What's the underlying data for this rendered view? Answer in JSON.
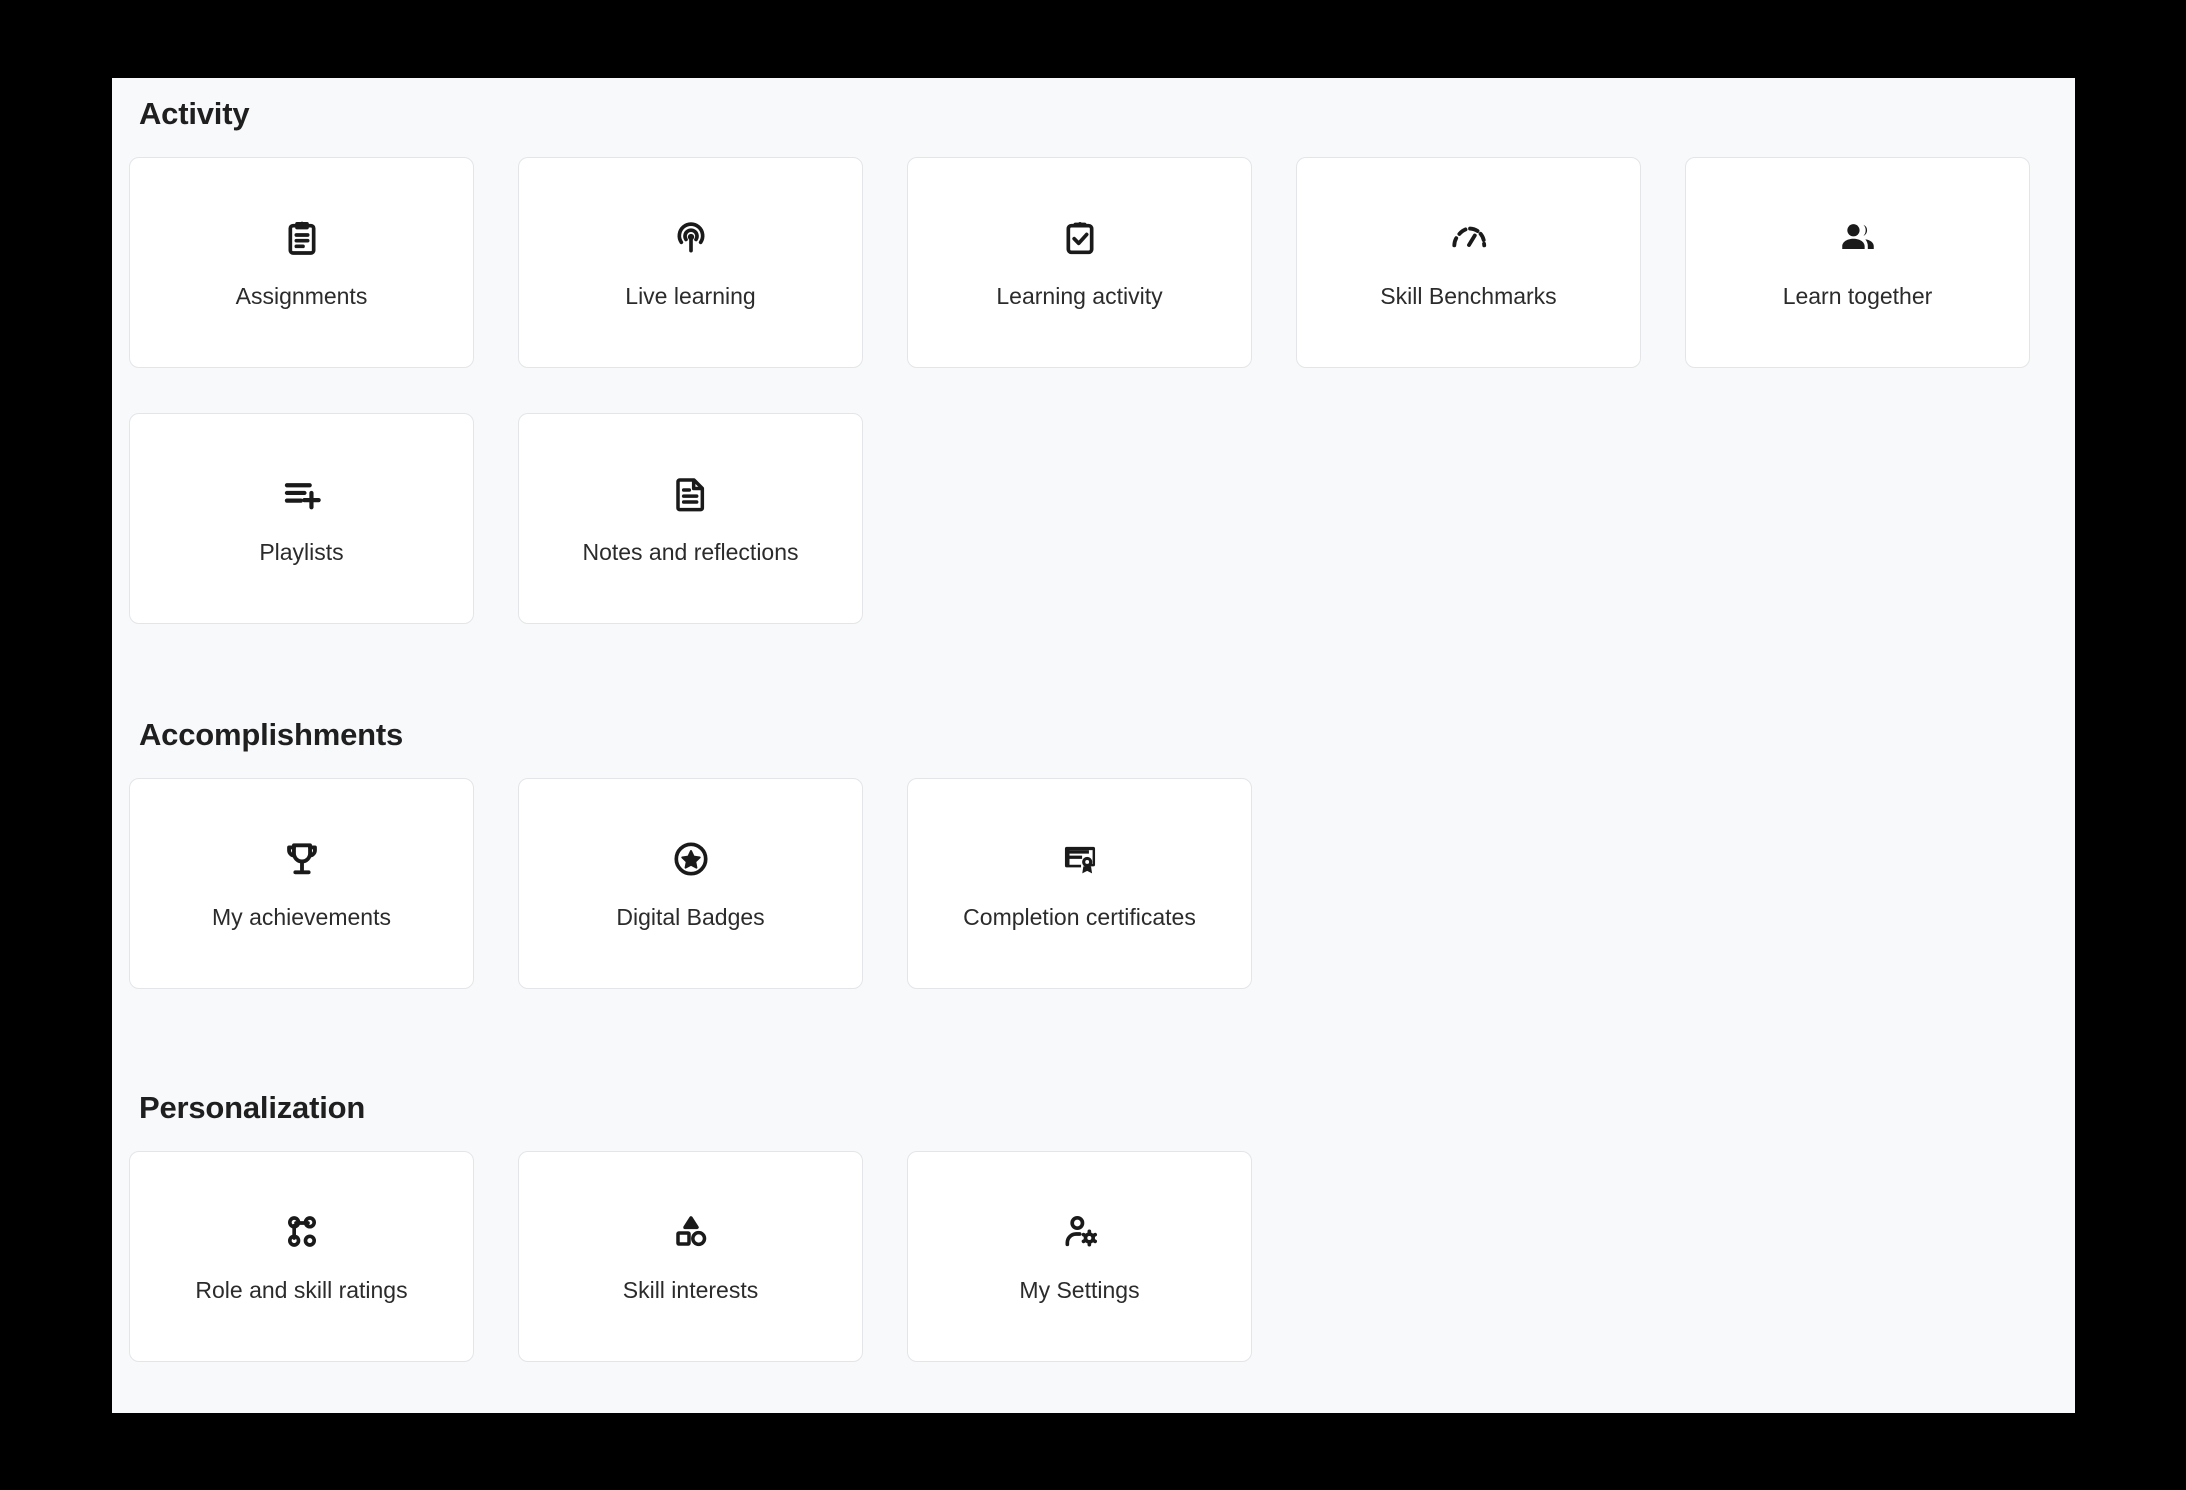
{
  "theme": {
    "page_background": "#000000",
    "content_background": "#f8f9fb",
    "card_background": "#ffffff",
    "card_border": "#e3e5e8",
    "heading_color": "#1f1f1f",
    "label_color": "#2b2b2b",
    "icon_color": "#1a1a1a"
  },
  "sections": {
    "activity": {
      "title": "Activity",
      "cards": [
        {
          "label": "Assignments",
          "icon": "clipboard-lines-icon"
        },
        {
          "label": "Live learning",
          "icon": "broadcast-antenna-icon"
        },
        {
          "label": "Learning activity",
          "icon": "clipboard-check-icon"
        },
        {
          "label": "Skill Benchmarks",
          "icon": "gauge-icon"
        },
        {
          "label": "Learn together",
          "icon": "people-group-icon"
        },
        {
          "label": "Playlists",
          "icon": "playlist-add-icon"
        },
        {
          "label": "Notes and reflections",
          "icon": "document-lines-icon"
        }
      ]
    },
    "accomplishments": {
      "title": "Accomplishments",
      "cards": [
        {
          "label": "My achievements",
          "icon": "trophy-icon"
        },
        {
          "label": "Digital Badges",
          "icon": "star-circle-icon"
        },
        {
          "label": "Completion certificates",
          "icon": "certificate-seal-icon"
        }
      ]
    },
    "personalization": {
      "title": "Personalization",
      "cards": [
        {
          "label": "Role and skill ratings",
          "icon": "node-graph-icon"
        },
        {
          "label": "Skill interests",
          "icon": "shapes-icon"
        },
        {
          "label": "My Settings",
          "icon": "person-gear-icon"
        }
      ]
    }
  }
}
